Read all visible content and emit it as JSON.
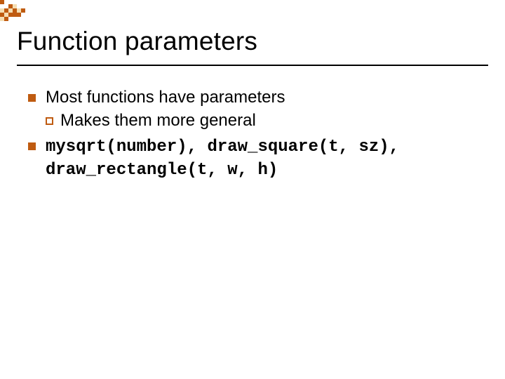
{
  "title": "Function parameters",
  "bullets": [
    {
      "text": "Most functions have parameters",
      "style": "normal",
      "children": [
        {
          "text": "Makes them more general",
          "style": "normal"
        }
      ]
    },
    {
      "text": "mysqrt(number), draw_square(t, sz), draw_rectangle(t, w, h)",
      "style": "mono",
      "children": []
    }
  ],
  "logo_colors": {
    "orange": "#bf5b11",
    "cream": "#f5deb3"
  }
}
